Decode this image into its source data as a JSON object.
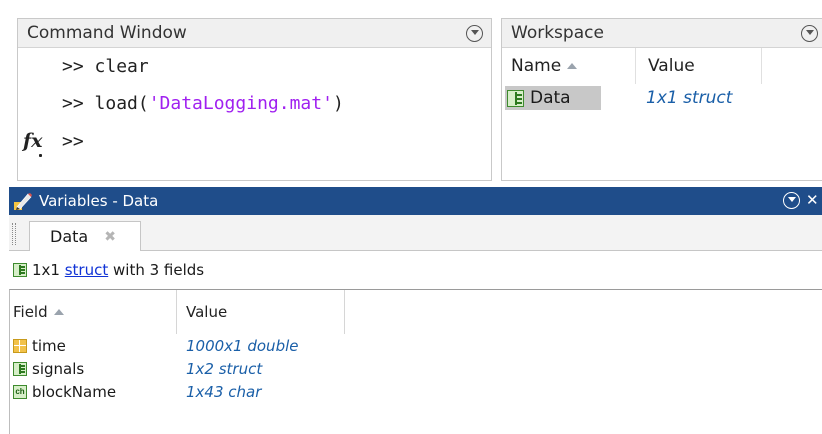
{
  "command_window": {
    "title": "Command Window",
    "lines": [
      {
        "prompt": ">> ",
        "code": "clear"
      },
      {
        "prompt": ">> ",
        "code_pre": "load(",
        "code_str": "'DataLogging.mat'",
        "code_post": ")"
      },
      {
        "prompt": ">>"
      }
    ],
    "fx_label": "fx"
  },
  "workspace": {
    "title": "Workspace",
    "columns": [
      "Name",
      "Value"
    ],
    "rows": [
      {
        "name": "Data",
        "value": "1x1 struct",
        "icon": "struct-icon"
      }
    ]
  },
  "variables": {
    "title": "Variables - Data",
    "tab_label": "Data",
    "tab_close": "✖",
    "summary": {
      "prefix": "1x1 ",
      "link": "struct",
      "suffix": " with 3 fields"
    },
    "columns": [
      "Field",
      "Value"
    ],
    "fields": [
      {
        "name": "time",
        "value": "1000x1 double",
        "icon": "double-icon"
      },
      {
        "name": "signals",
        "value": "1x2 struct",
        "icon": "struct-icon"
      },
      {
        "name": "blockName",
        "value": "1x43 char",
        "icon": "char-icon"
      }
    ]
  },
  "colors": {
    "title_bar": "#1f4d8a",
    "value_text": "#1a5fa8",
    "string_literal": "#a020f0",
    "link": "#1033d6"
  }
}
